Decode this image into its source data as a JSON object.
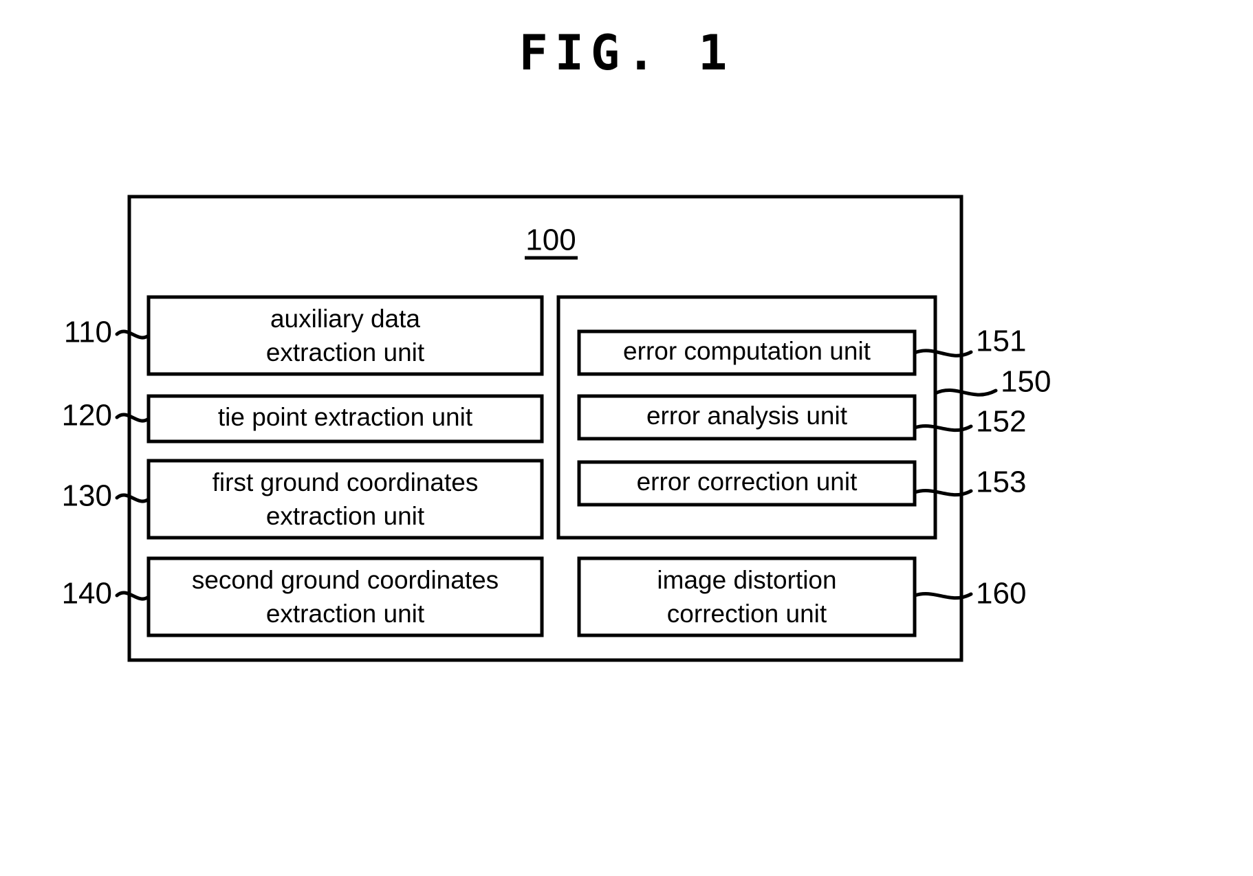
{
  "figure": {
    "title": "FIG. 1",
    "system_id": "100"
  },
  "left_column": [
    {
      "ref": "110",
      "label_line1": "auxiliary data",
      "label_line2": "extraction unit"
    },
    {
      "ref": "120",
      "label_line1": "tie point extraction unit",
      "label_line2": ""
    },
    {
      "ref": "130",
      "label_line1": "first ground coordinates",
      "label_line2": "extraction unit"
    },
    {
      "ref": "140",
      "label_line1": "second ground coordinates",
      "label_line2": "extraction unit"
    }
  ],
  "right_group": {
    "ref": "150",
    "items": [
      {
        "ref": "151",
        "label_line1": "error computation unit",
        "label_line2": ""
      },
      {
        "ref": "152",
        "label_line1": "error analysis unit",
        "label_line2": ""
      },
      {
        "ref": "153",
        "label_line1": "error correction unit",
        "label_line2": ""
      }
    ]
  },
  "right_standalone": [
    {
      "ref": "160",
      "label_line1": "image distortion",
      "label_line2": "correction unit"
    }
  ],
  "colors": {
    "stroke": "#000000",
    "background": "#ffffff",
    "text": "#000000"
  }
}
